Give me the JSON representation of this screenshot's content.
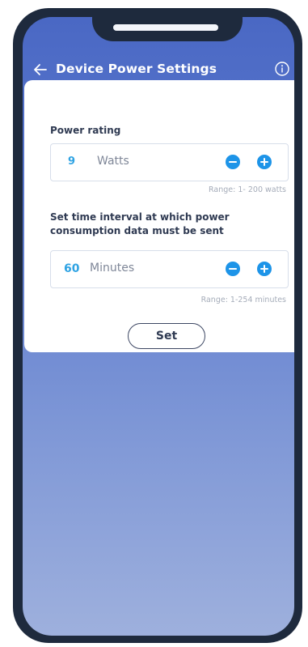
{
  "header": {
    "back_icon": "arrow-left-icon",
    "title": "Device Power Settings",
    "info_icon": "info-circle-icon"
  },
  "power_rating": {
    "label": "Power rating",
    "value": "9",
    "unit": "Watts",
    "range": "Range: 1- 200 watts"
  },
  "interval": {
    "label_line1": "Set time interval at which power",
    "label_line2": "consumption data must be sent",
    "value": "60",
    "unit": "Minutes",
    "range": "Range: 1-254 minutes"
  },
  "set_button_label": "Set",
  "colors": {
    "accent": "#1d94e8",
    "value_text": "#2fa3e3",
    "bg_top": "#4a68c4",
    "bg_bottom": "#9eb0dd",
    "phone_frame": "#1e2a3d"
  }
}
